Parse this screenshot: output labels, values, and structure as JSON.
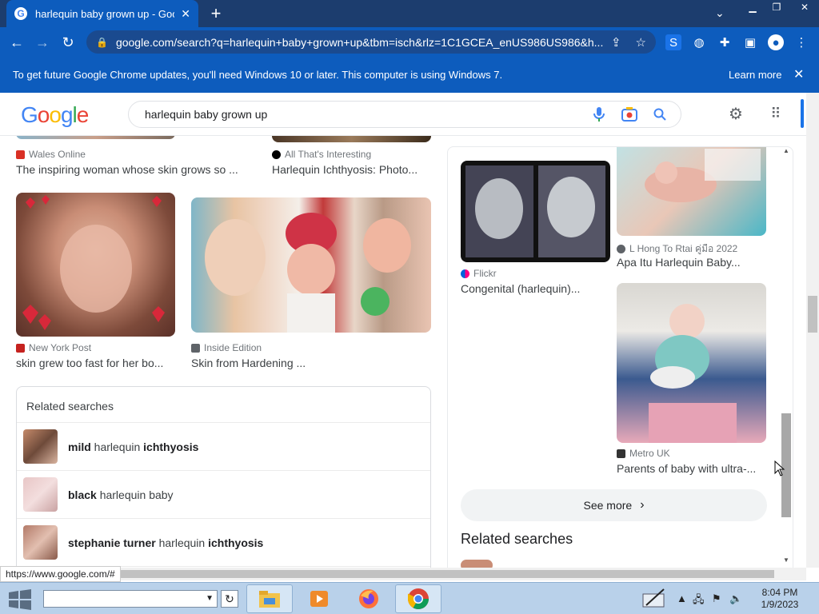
{
  "browser": {
    "tab_title": "harlequin baby grown up - Goog",
    "tab_favicon": "G",
    "url": "google.com/search?q=harlequin+baby+grown+up&tbm=isch&rlz=1C1GCEA_enUS986US986&h...",
    "status_url": "https://www.google.com/#"
  },
  "infobar": {
    "message": "To get future Google Chrome updates, you'll need Windows 10 or later. This computer is using Windows 7.",
    "learn_more": "Learn more"
  },
  "google": {
    "query": "harlequin baby grown up"
  },
  "left_results": [
    {
      "source": "Wales Online",
      "caption": "The inspiring woman whose skin grows so ...",
      "icon_color": "#d93025"
    },
    {
      "source": "All That's Interesting",
      "caption": "Harlequin Ichthyosis: Photo...",
      "icon_color": "#000000"
    },
    {
      "source": "New York Post",
      "caption": "skin grew too fast for her bo...",
      "icon_color": "#c5221f"
    },
    {
      "source": "Inside Edition",
      "caption": "Skin from Hardening ...",
      "icon_color": "#5f6368"
    }
  ],
  "related": {
    "heading": "Related searches",
    "rows": [
      {
        "bold1": "mild",
        "normal": " harlequin ",
        "bold2": "ichthyosis"
      },
      {
        "bold1": "black",
        "normal": " harlequin baby",
        "bold2": ""
      },
      {
        "bold1": "stephanie turner",
        "normal": " harlequin ",
        "bold2": "ichthyosis"
      }
    ]
  },
  "panel": {
    "results": [
      {
        "source": "Flickr",
        "caption": "Congenital (harlequin)..."
      },
      {
        "source": "L Hong To Rtai คู่มือ 2022",
        "caption": "Apa Itu Harlequin Baby..."
      },
      {
        "source": "Metro UK",
        "caption": "Parents of baby with ultra-..."
      }
    ],
    "see_more": "See more",
    "related_heading": "Related searches"
  },
  "taskbar": {
    "time": "8:04 PM",
    "date": "1/9/2023"
  }
}
